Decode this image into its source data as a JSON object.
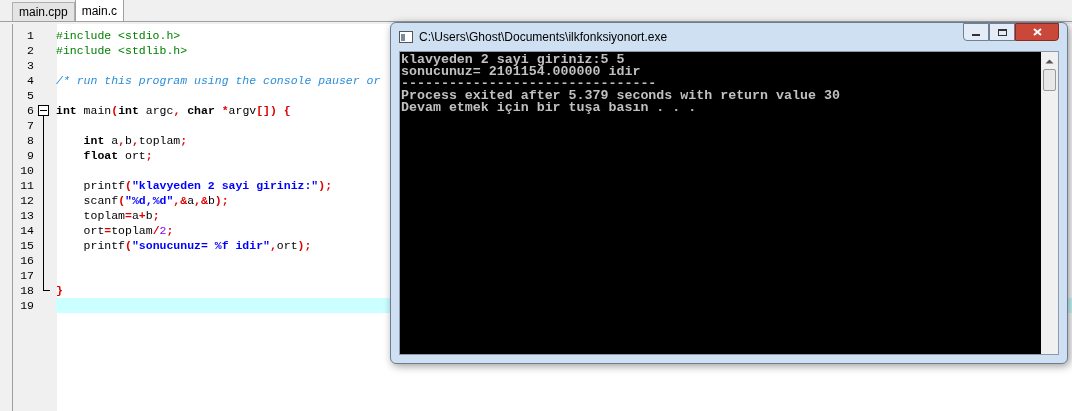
{
  "tabs": [
    {
      "label": "main.cpp",
      "selected": false
    },
    {
      "label": "main.c",
      "selected": true
    }
  ],
  "editor": {
    "lines": [
      {
        "number": "1",
        "current": false,
        "kind": "plain",
        "tokens": [
          {
            "kind": "preprocessor",
            "text": "#include <stdio.h>"
          }
        ]
      },
      {
        "number": "2",
        "current": false,
        "kind": "plain",
        "tokens": [
          {
            "kind": "preprocessor",
            "text": "#include <stdlib.h>"
          }
        ]
      },
      {
        "number": "3",
        "current": false,
        "kind": "plain"
      },
      {
        "number": "4",
        "current": false,
        "kind": "plain",
        "tokens": [
          {
            "kind": "comment",
            "text": "/* run this program using the console pauser or"
          }
        ]
      },
      {
        "number": "5",
        "current": false,
        "kind": "plain"
      },
      {
        "number": "6",
        "current": false,
        "kind": "foldstart",
        "tokens": [
          {
            "kind": "keyword",
            "text": "int"
          },
          {
            "kind": "ident",
            "text": " main"
          },
          {
            "kind": "punct",
            "text": "("
          },
          {
            "kind": "keyword",
            "text": "int"
          },
          {
            "kind": "ident",
            "text": " argc"
          },
          {
            "kind": "punct",
            "text": ","
          },
          {
            "kind": "keyword",
            "text": " char"
          },
          {
            "kind": "punct",
            "text": " *"
          },
          {
            "kind": "ident",
            "text": "argv"
          },
          {
            "kind": "punct",
            "text": "[]) {"
          }
        ]
      },
      {
        "number": "7",
        "current": false,
        "kind": "foldbody"
      },
      {
        "number": "8",
        "current": false,
        "kind": "foldbody",
        "tokens": [
          {
            "kind": "keyword",
            "text": "    int"
          },
          {
            "kind": "ident",
            "text": " a"
          },
          {
            "kind": "punct",
            "text": ","
          },
          {
            "kind": "ident",
            "text": "b"
          },
          {
            "kind": "punct",
            "text": ","
          },
          {
            "kind": "ident",
            "text": "toplam"
          },
          {
            "kind": "punct",
            "text": ";"
          }
        ]
      },
      {
        "number": "9",
        "current": false,
        "kind": "foldbody",
        "tokens": [
          {
            "kind": "keyword",
            "text": "    float"
          },
          {
            "kind": "ident",
            "text": " ort"
          },
          {
            "kind": "punct",
            "text": ";"
          }
        ]
      },
      {
        "number": "10",
        "current": false,
        "kind": "foldbody"
      },
      {
        "number": "11",
        "current": false,
        "kind": "foldbody",
        "tokens": [
          {
            "kind": "ident",
            "text": "    printf"
          },
          {
            "kind": "punct",
            "text": "("
          },
          {
            "kind": "string",
            "text": "\"klavyeden 2 sayi giriniz:\""
          },
          {
            "kind": "punct",
            "text": ");"
          }
        ]
      },
      {
        "number": "12",
        "current": false,
        "kind": "foldbody",
        "tokens": [
          {
            "kind": "ident",
            "text": "    scanf"
          },
          {
            "kind": "punct",
            "text": "("
          },
          {
            "kind": "string",
            "text": "\"%d,%d\""
          },
          {
            "kind": "punct",
            "text": ",&"
          },
          {
            "kind": "ident",
            "text": "a"
          },
          {
            "kind": "punct",
            "text": ",&"
          },
          {
            "kind": "ident",
            "text": "b"
          },
          {
            "kind": "punct",
            "text": ");"
          }
        ]
      },
      {
        "number": "13",
        "current": false,
        "kind": "foldbody",
        "tokens": [
          {
            "kind": "ident",
            "text": "    toplam"
          },
          {
            "kind": "punct",
            "text": "="
          },
          {
            "kind": "ident",
            "text": "a"
          },
          {
            "kind": "punct",
            "text": "+"
          },
          {
            "kind": "ident",
            "text": "b"
          },
          {
            "kind": "punct",
            "text": ";"
          }
        ]
      },
      {
        "number": "14",
        "current": false,
        "kind": "foldbody",
        "tokens": [
          {
            "kind": "ident",
            "text": "    ort"
          },
          {
            "kind": "punct",
            "text": "="
          },
          {
            "kind": "ident",
            "text": "toplam"
          },
          {
            "kind": "punct",
            "text": "/"
          },
          {
            "kind": "number",
            "text": "2"
          },
          {
            "kind": "punct",
            "text": ";"
          }
        ]
      },
      {
        "number": "15",
        "current": false,
        "kind": "foldbody",
        "tokens": [
          {
            "kind": "ident",
            "text": "    printf"
          },
          {
            "kind": "punct",
            "text": "("
          },
          {
            "kind": "string",
            "text": "\"sonucunuz= %f idir\""
          },
          {
            "kind": "punct",
            "text": ","
          },
          {
            "kind": "ident",
            "text": "ort"
          },
          {
            "kind": "punct",
            "text": ");"
          }
        ]
      },
      {
        "number": "16",
        "current": false,
        "kind": "foldbody"
      },
      {
        "number": "17",
        "current": false,
        "kind": "foldbody"
      },
      {
        "number": "18",
        "current": false,
        "kind": "foldend",
        "tokens": [
          {
            "kind": "punct",
            "text": "}"
          }
        ]
      },
      {
        "number": "19",
        "current": true,
        "kind": "plain"
      }
    ]
  },
  "console": {
    "title": "C:\\Users\\Ghost\\Documents\\ilkfonksiyonort.exe",
    "lines": [
      "klavyeden 2 sayi giriniz:5 5",
      "sonucunuz= 2101154.000000 idir",
      "--------------------------------",
      "Process exited after 5.379 seconds with return value 30",
      "Devam etmek için bir tuşa basın . . ."
    ]
  }
}
